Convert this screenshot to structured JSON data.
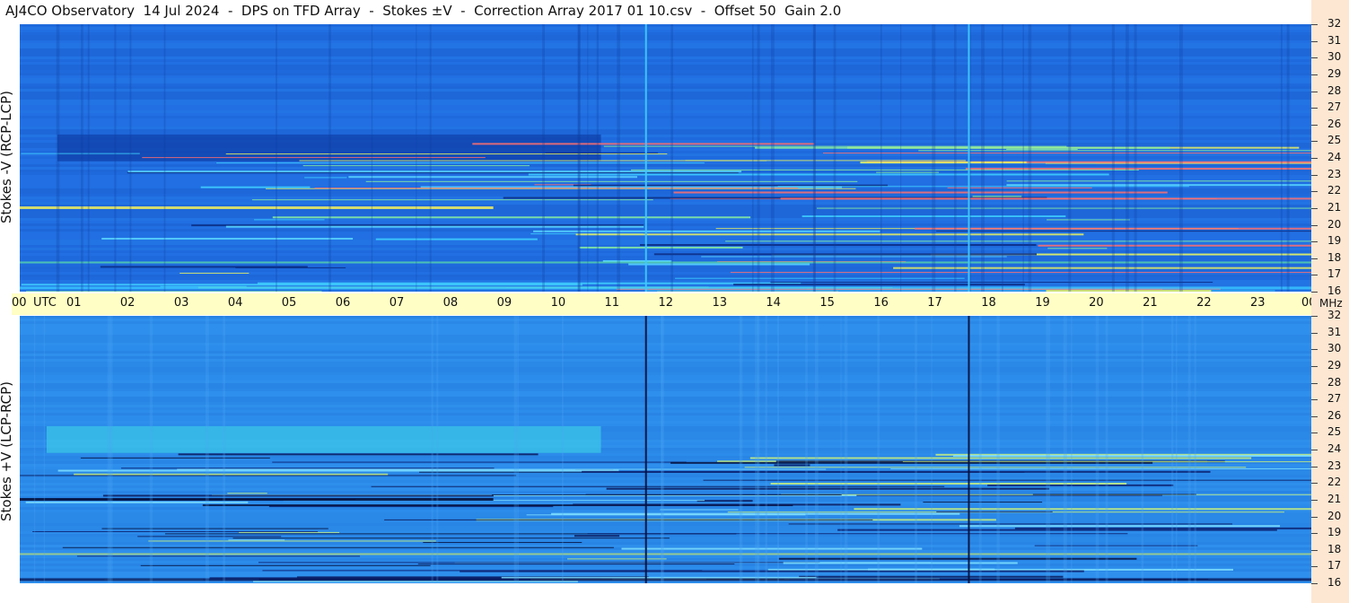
{
  "title": "AJ4CO Observatory  14 Jul 2024  -  DPS on TFD Array  -  Stokes ±V  -  Correction Array 2017 01 10.csv  -  Offset 50  Gain 2.0",
  "panels": {
    "top": {
      "ylabel": "Stokes -V (RCP-LCP)"
    },
    "bottom": {
      "ylabel": "Stokes +V (LCP-RCP)"
    }
  },
  "colors": {
    "top_base": "#1f6fe0",
    "bottom_base": "#2a8ae8",
    "utc_band": "#fffec4",
    "right_strip": "#fde7d2"
  },
  "chart_data": {
    "type": "heatmap",
    "x_axis": {
      "unit": "UTC",
      "ticks": [
        "00",
        "01",
        "02",
        "03",
        "04",
        "05",
        "06",
        "07",
        "08",
        "09",
        "10",
        "11",
        "12",
        "13",
        "14",
        "15",
        "16",
        "17",
        "18",
        "19",
        "20",
        "21",
        "22",
        "23",
        "00"
      ],
      "range": [
        0,
        24
      ]
    },
    "y_axis": {
      "unit": "MHz",
      "ticks": [
        "32",
        "31",
        "30",
        "29",
        "28",
        "27",
        "26",
        "25",
        "24",
        "23",
        "22",
        "21",
        "20",
        "19",
        "18",
        "17",
        "16"
      ],
      "range": [
        16,
        32
      ]
    },
    "x_unit_label": "UTC",
    "y_unit_label": "MHz",
    "vertical_lines_utc": [
      11.62,
      17.62
    ],
    "dark_band_top": {
      "x_range": [
        0.7,
        10.8
      ],
      "y_range": [
        23.8,
        25.4
      ]
    },
    "light_band_bottom": {
      "x_range": [
        0.5,
        10.8
      ],
      "y_range": [
        23.8,
        25.4
      ]
    }
  }
}
